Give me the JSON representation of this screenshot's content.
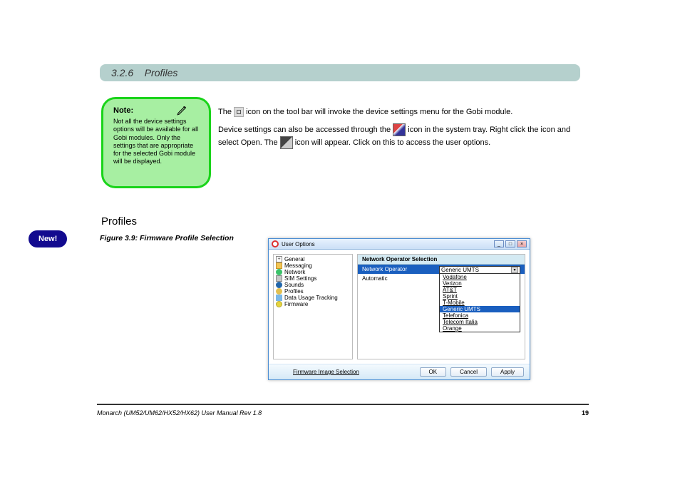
{
  "header": {
    "section_number": "3.2.6",
    "title": "Profiles"
  },
  "note": {
    "label": "Note:",
    "text": "Not all the device settings options will be available for all Gobi modules. Only the settings that are appropriate for the selected Gobi module will be displayed."
  },
  "body": {
    "p1_a": "The ",
    "p1_b": " icon on the tool bar will invoke the device settings menu for the Gobi module.",
    "p2_a": "Device settings can also be accessed through the ",
    "p2_b": " icon in the system tray. Right click the icon and select Open. The ",
    "p2_c": " icon will appear. Click on this to access the user options."
  },
  "profile": {
    "heading": "Profiles",
    "new_badge": "New!",
    "fig_caption": "Figure 3.9: Firmware Profile Selection"
  },
  "dialog": {
    "title": "User Options",
    "tree": [
      {
        "icon": "plus",
        "label": "General"
      },
      {
        "icon": "folder",
        "label": "Messaging"
      },
      {
        "icon": "globe",
        "label": "Network"
      },
      {
        "icon": "sim",
        "label": "SIM Settings"
      },
      {
        "icon": "sound",
        "label": "Sounds"
      },
      {
        "icon": "prof",
        "label": "Profiles"
      },
      {
        "icon": "usage",
        "label": "Data Usage Tracking"
      },
      {
        "icon": "fw",
        "label": "Firmware"
      }
    ],
    "panel_title": "Network Operator Selection",
    "row_label_1": "Network Operator",
    "row_label_2": "Automatic",
    "dropdown_current": "Generic UMTS",
    "dropdown_items": [
      "Vodafone",
      "Verizon",
      "AT&T",
      "Sprint",
      "T-Mobile",
      "Generic UMTS",
      "Telefonica",
      "Telecom Italia",
      "Orange"
    ],
    "footer_link": "Firmware Image Selection",
    "buttons": {
      "ok": "OK",
      "cancel": "Cancel",
      "apply": "Apply"
    }
  },
  "footer": {
    "left": "Monarch (UM52/UM62/HX52/HX62) User Manual Rev 1.8",
    "right": "19"
  }
}
